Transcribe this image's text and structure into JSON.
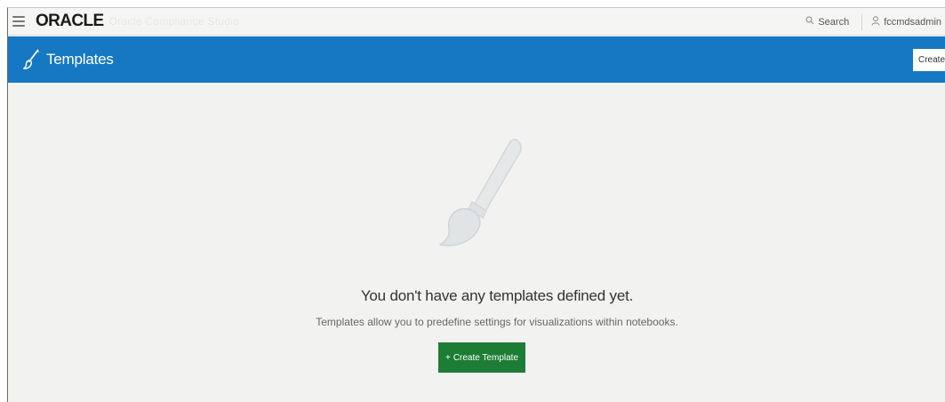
{
  "topbar": {
    "logo": "ORACLE",
    "product_name": "Oracle Compliance Studio",
    "search_label": "Search",
    "username": "fccmdsadmin"
  },
  "header": {
    "title": "Templates",
    "create_label": "Create"
  },
  "empty_state": {
    "title": "You don't have any templates defined yet.",
    "description": "Templates allow you to predefine settings for visualizations within notebooks.",
    "button_plus": "+",
    "button_label": "Create Template"
  },
  "icons": {
    "menu": "hamburger-menu-icon",
    "search": "search-icon",
    "user": "user-icon",
    "header": "paintbrush-icon",
    "illustration": "paintbrush-illustration-icon"
  },
  "colors": {
    "header_bg": "#1678c2",
    "primary_button": "#1d7d34",
    "page_bg": "#f2f2f1"
  }
}
